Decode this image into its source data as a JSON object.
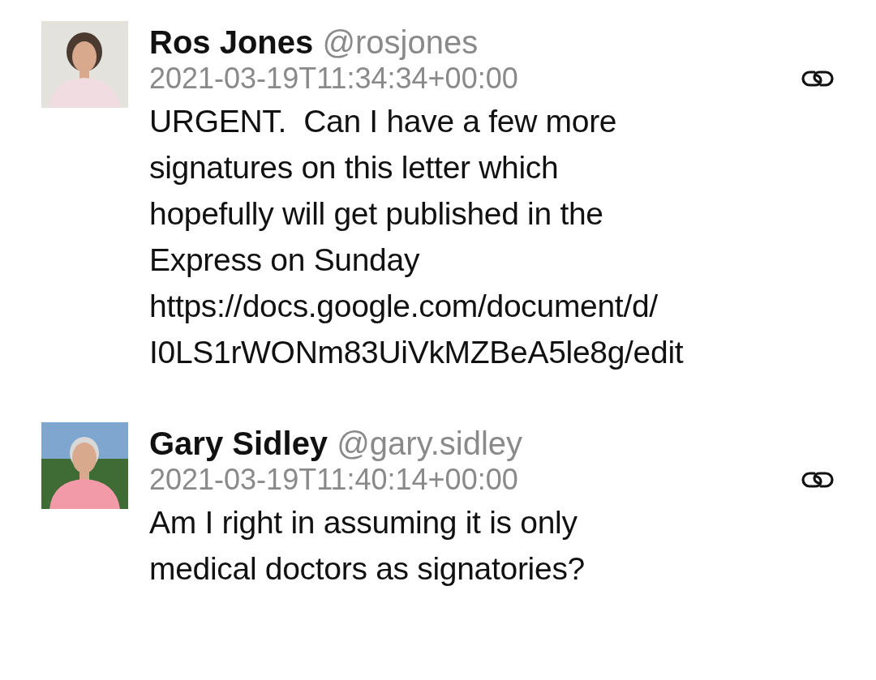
{
  "messages": [
    {
      "name": "Ros Jones",
      "handle": "@rosjones",
      "timestamp": "2021-03-19T11:34:34+00:00",
      "text_lines": [
        "URGENT.  Can I have a few more",
        "signatures on this letter which",
        "hopefully will get published in the",
        "Express on Sunday",
        "https://docs.google.com/document/d/",
        "I0LS1rWONm83UiVkMZBeA5le8g/edit"
      ]
    },
    {
      "name": "Gary Sidley",
      "handle": "@gary.sidley",
      "timestamp": "2021-03-19T11:40:14+00:00",
      "text_lines": [
        "Am I right in assuming it is only",
        "medical doctors as signatories?"
      ]
    }
  ]
}
